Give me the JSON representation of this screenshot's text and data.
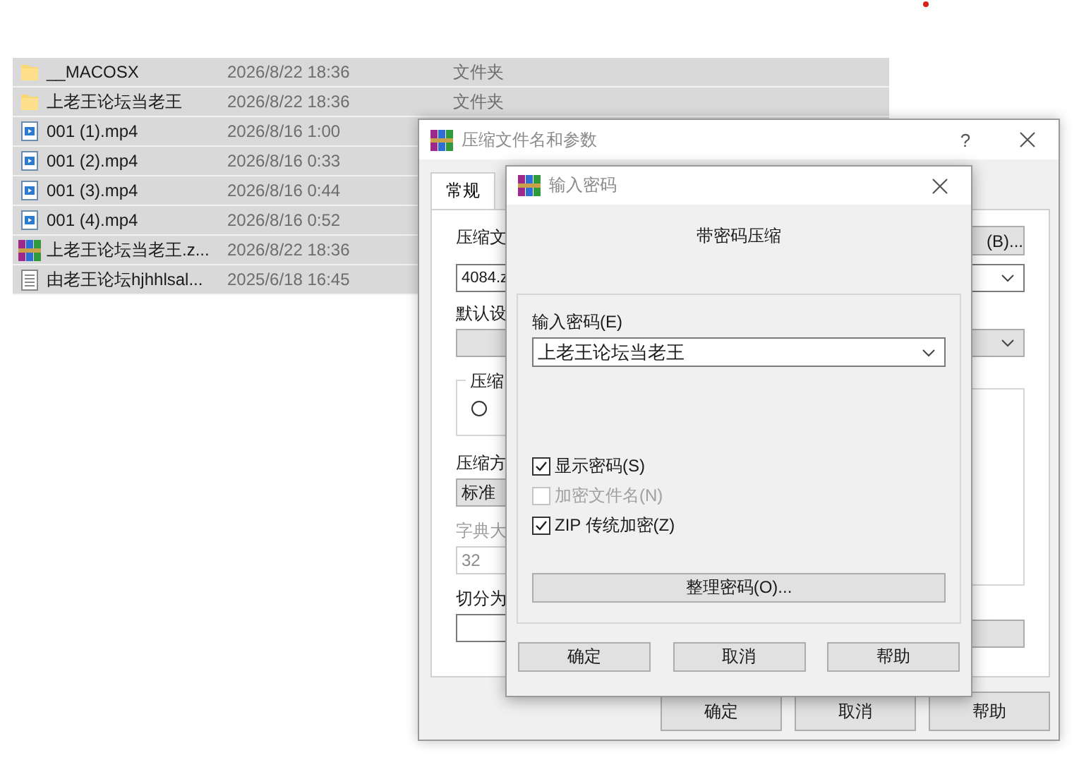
{
  "file_list": {
    "rows": [
      {
        "kind": "folder",
        "name": "__MACOSX",
        "date": "2026/8/22 18:36",
        "type": "文件夹"
      },
      {
        "kind": "folder",
        "name": "上老王论坛当老王",
        "date": "2026/8/22 18:36",
        "type": "文件夹"
      },
      {
        "kind": "video",
        "name": "001 (1).mp4",
        "date": "2026/8/16 1:00"
      },
      {
        "kind": "video",
        "name": "001 (2).mp4",
        "date": "2026/8/16 0:33"
      },
      {
        "kind": "video",
        "name": "001 (3).mp4",
        "date": "2026/8/16 0:44"
      },
      {
        "kind": "video",
        "name": "001 (4).mp4",
        "date": "2026/8/16 0:52"
      },
      {
        "kind": "archive",
        "name": "上老王论坛当老王.z...",
        "date": "2026/8/22 18:36"
      },
      {
        "kind": "text",
        "name": "由老王论坛hjhhlsal...",
        "date": "2025/6/18 16:45"
      }
    ]
  },
  "archive_dialog": {
    "title": "压缩文件名和参数",
    "help": "?",
    "tabs": [
      {
        "label": "常规",
        "selected": true
      }
    ],
    "archive_name_label": "压缩文",
    "archive_name_value": "4084.z",
    "browse_button": "(B)...",
    "profile_label": "默认设",
    "format_group_label": "压缩",
    "format_radio": {
      "selected": false
    },
    "method_label": "压缩方",
    "method_value": "标准",
    "dictionary": {
      "label": "字典大",
      "value": "32",
      "disabled": true
    },
    "split_label": "切分为",
    "buttons": [
      "确定",
      "取消",
      "帮助"
    ]
  },
  "password_dialog": {
    "title": "输入密码",
    "heading": "带密码压缩",
    "password_label": "输入密码(E)",
    "password_value": "上老王论坛当老王",
    "options": [
      {
        "label": "显示密码(S)",
        "checked": true,
        "disabled": false
      },
      {
        "label": "加密文件名(N)",
        "checked": false,
        "disabled": true
      },
      {
        "label": "ZIP 传统加密(Z)",
        "checked": true,
        "disabled": false
      }
    ],
    "organize_button": "整理密码(O)...",
    "buttons": [
      "确定",
      "取消",
      "帮助"
    ]
  }
}
